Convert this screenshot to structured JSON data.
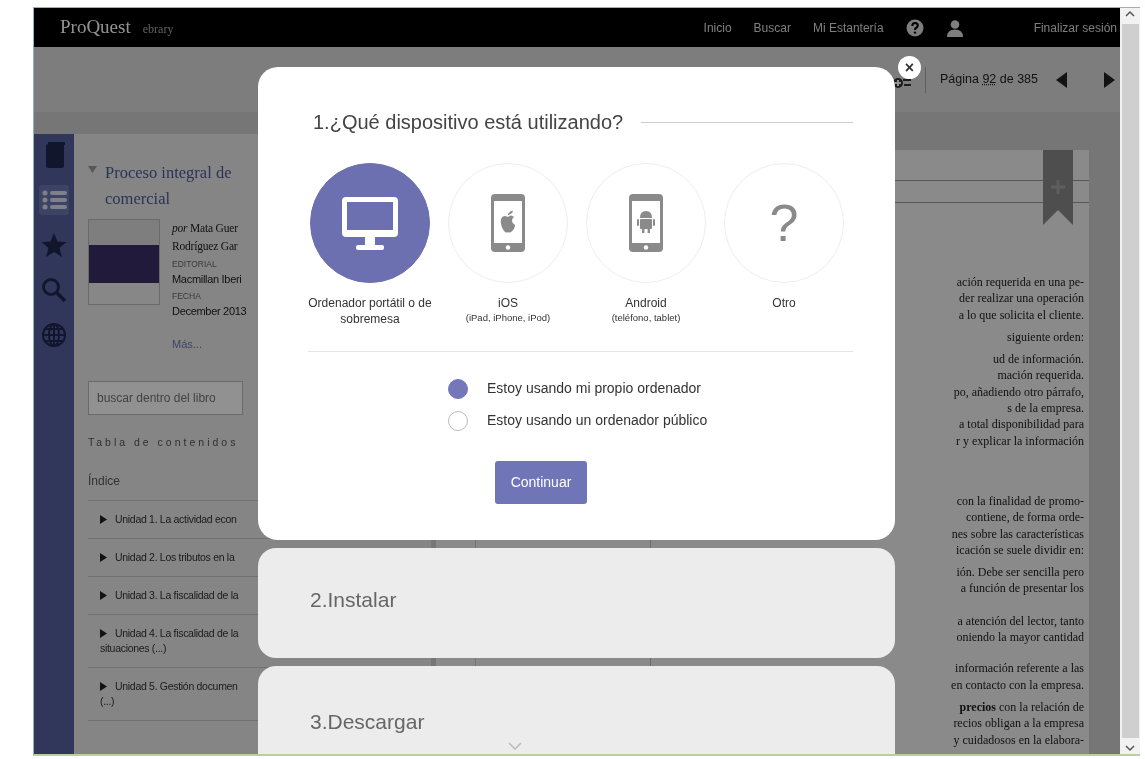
{
  "app_bar": {
    "brand": "ProQuest",
    "product": "ebrary",
    "links": [
      "Inicio",
      "Buscar",
      "Mi Estantería"
    ],
    "logout": "Finalizar sesión"
  },
  "toolbar": {
    "page_label": "Página",
    "page_number": "92",
    "page_total": "de 385"
  },
  "sidebar_tools": [
    {
      "kind": "book",
      "selected": false
    },
    {
      "kind": "contents",
      "selected": true
    },
    {
      "kind": "favorites",
      "selected": false
    },
    {
      "kind": "search",
      "selected": false
    },
    {
      "kind": "web",
      "selected": false
    }
  ],
  "book": {
    "title_lines": [
      "Proceso integral de",
      "comercial"
    ],
    "author_lines": [
      "*por* Mata Guer",
      "Rodríguez Gar"
    ],
    "publisher_label": "EDITORIAL",
    "publisher": "Macmillan Iberi",
    "date_label": "FECHA",
    "date": "December 2013",
    "more": "Más..."
  },
  "book_search": {
    "placeholder": "buscar dentro del libro"
  },
  "contents": {
    "heading": "Tabla de contenidos",
    "items": [
      {
        "lines": [
          "Índice"
        ],
        "expandable": false
      },
      {
        "lines": [
          "Unidad 1. La actividad econ"
        ],
        "expandable": true
      },
      {
        "lines": [
          "Unidad 2. Los tributos en la"
        ],
        "expandable": true
      },
      {
        "lines": [
          "Unidad 3. La fiscalidad de la"
        ],
        "expandable": true
      },
      {
        "lines": [
          "Unidad 4. La fiscalidad de la",
          "situaciones (...)"
        ],
        "expandable": true
      },
      {
        "lines": [
          "Unidad 5. Gestión documen",
          "(...)"
        ],
        "expandable": true
      }
    ]
  },
  "page": {
    "partial_paragraphs": [
      [
        "ación requerida en una pe-",
        "der realizar una operación",
        "a lo que solicita el cliente."
      ],
      [
        "siguiente orden:"
      ],
      [
        "ud de información.",
        "mación requerida.",
        "po, añadiendo otro párrafo,",
        "s de la empresa.",
        "a total disponibilidad para",
        "r y explicar la información"
      ],
      [
        "con la finalidad de promo-",
        "contiene, de forma orde-",
        "nes sobre las características",
        "icación se suele dividir en:"
      ],
      [
        "ión. Debe ser sencilla pero",
        "a función de presentar los"
      ],
      [
        "a atención del lector, tanto",
        "oniendo la mayor cantidad"
      ],
      [
        "información referente a las",
        "en contacto con la empresa."
      ],
      [
        "**precios** con la relación de",
        "recios obligan a la empresa",
        "y cuidadosos en la elabora-"
      ]
    ]
  },
  "dialog": {
    "close": "×",
    "title": "1.¿Qué dispositivo está utilizando?",
    "devices": [
      {
        "kind": "desktop",
        "label": "Ordenador portátil o de sobremesa",
        "selected": true
      },
      {
        "kind": "ios",
        "label": "iOS",
        "note": "(iPad, iPhone, iPod)",
        "selected": false
      },
      {
        "kind": "android",
        "label": "Android",
        "note": "(teléfono, tablet)",
        "selected": false
      },
      {
        "kind": "other",
        "glyph": "?",
        "label": "Otro",
        "selected": false
      }
    ],
    "options": [
      {
        "label": "Estoy usando mi propio ordenador",
        "selected": true
      },
      {
        "label": "Estoy usando un ordenador público",
        "selected": false
      }
    ],
    "button": "Continuar"
  },
  "steps": [
    "2.Instalar",
    "3.Descargar"
  ]
}
